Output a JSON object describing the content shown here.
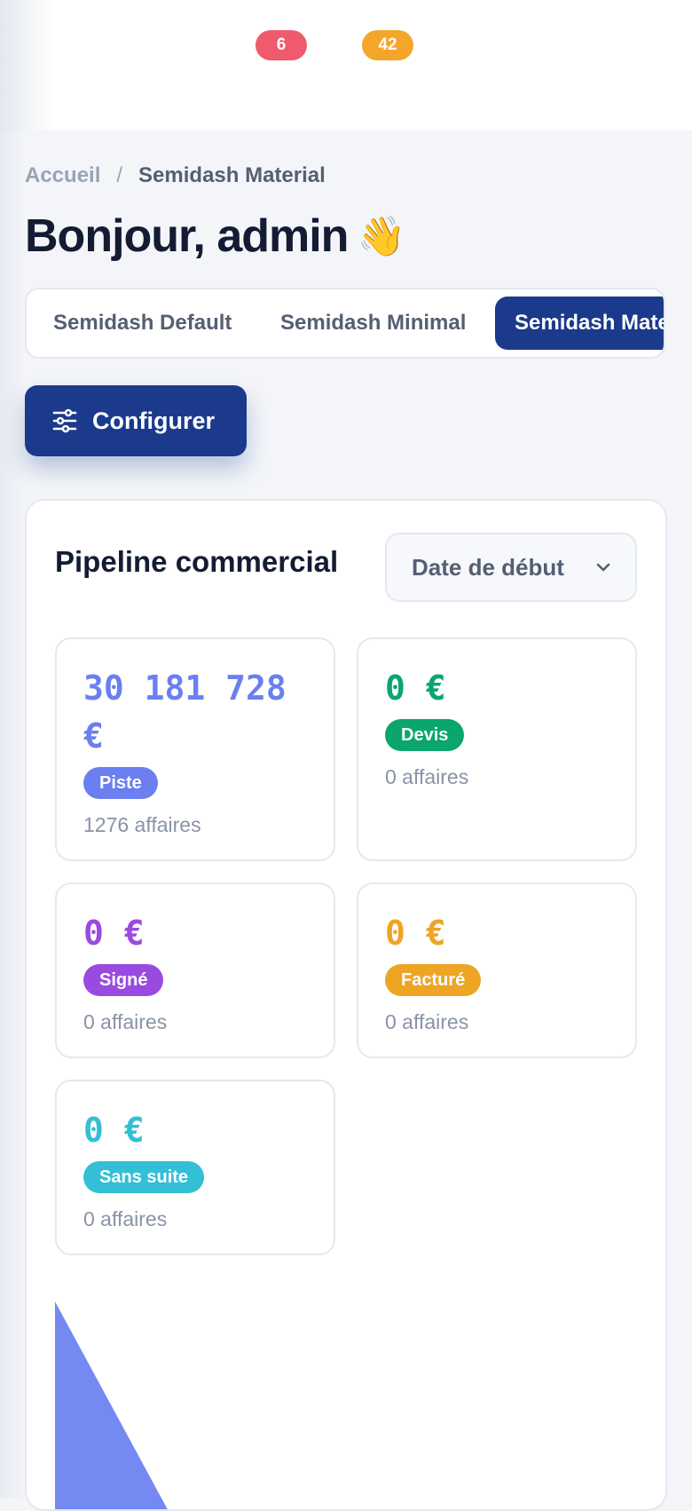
{
  "header": {
    "notification_count": "6",
    "message_count": "42"
  },
  "breadcrumb": {
    "home": "Accueil",
    "separator": "/",
    "current": "Semidash Material"
  },
  "greeting": {
    "text": "Bonjour, admin",
    "emoji": "👋"
  },
  "tabs": [
    {
      "label": "Semidash Default",
      "active": false
    },
    {
      "label": "Semidash Minimal",
      "active": false
    },
    {
      "label": "Semidash Material",
      "active": true
    }
  ],
  "configure_button": {
    "label": "Configurer",
    "icon": "sliders-icon"
  },
  "pipeline": {
    "title": "Pipeline commercial",
    "date_filter": "Date de début",
    "stages": [
      {
        "value": "30 181 728 €",
        "label": "Piste",
        "count": "1276 affaires",
        "color": "#6b7ff0"
      },
      {
        "value": "0 €",
        "label": "Devis",
        "count": "0 affaires",
        "color": "#0aa66e"
      },
      {
        "value": "0 €",
        "label": "Signé",
        "count": "0 affaires",
        "color": "#9a4bdf"
      },
      {
        "value": "0 €",
        "label": "Facturé",
        "count": "0 affaires",
        "color": "#eda523"
      },
      {
        "value": "0 €",
        "label": "Sans suite",
        "count": "0 affaires",
        "color": "#33bfd6"
      }
    ]
  },
  "colors": {
    "primary": "#1b3a8c",
    "badge_red": "#ef5b6c",
    "badge_orange": "#f4a62a",
    "chart_slice": "#7489f2"
  }
}
